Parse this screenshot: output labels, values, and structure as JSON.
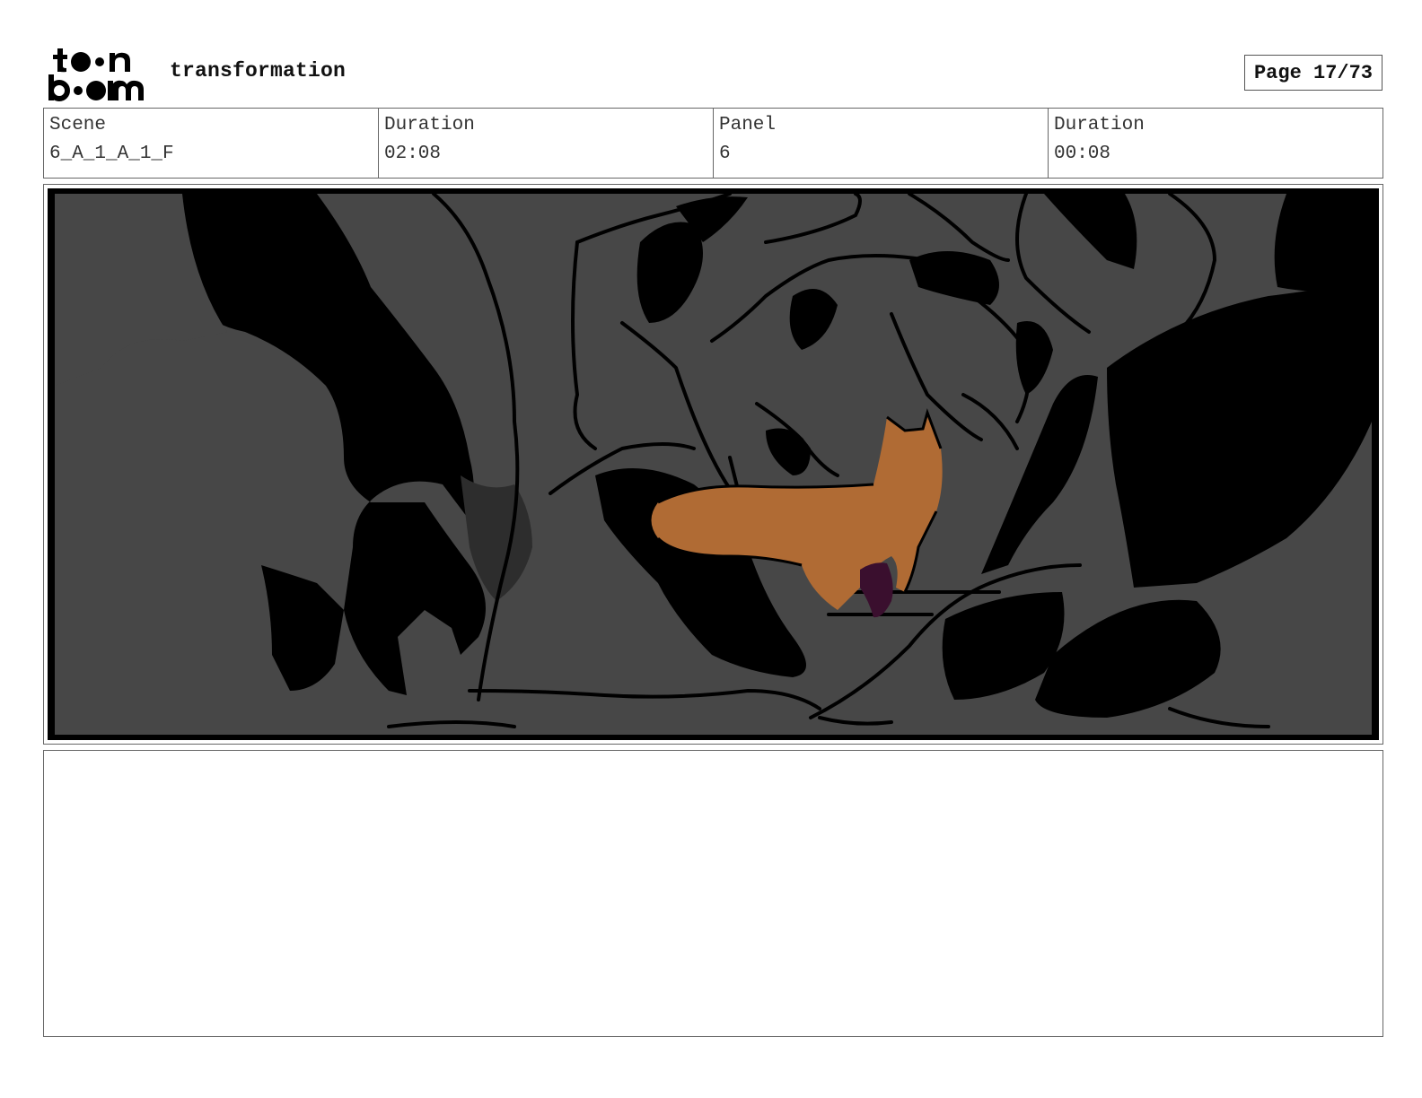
{
  "header": {
    "logo_text": "toon boom",
    "project_title": "transformation",
    "page_label": "Page 17/73"
  },
  "info": {
    "scene_label": "Scene",
    "scene_value": "6_A_1_A_1_F",
    "scene_duration_label": "Duration",
    "scene_duration_value": "02:08",
    "panel_label": "Panel",
    "panel_value": "6",
    "panel_duration_label": "Duration",
    "panel_duration_value": "00:08"
  },
  "panel": {
    "description": ""
  },
  "colors": {
    "background_gray": "#474747",
    "shadow_black": "#000000",
    "fox_orange": "#b06b34",
    "accent_purple": "#3a0f2e"
  }
}
